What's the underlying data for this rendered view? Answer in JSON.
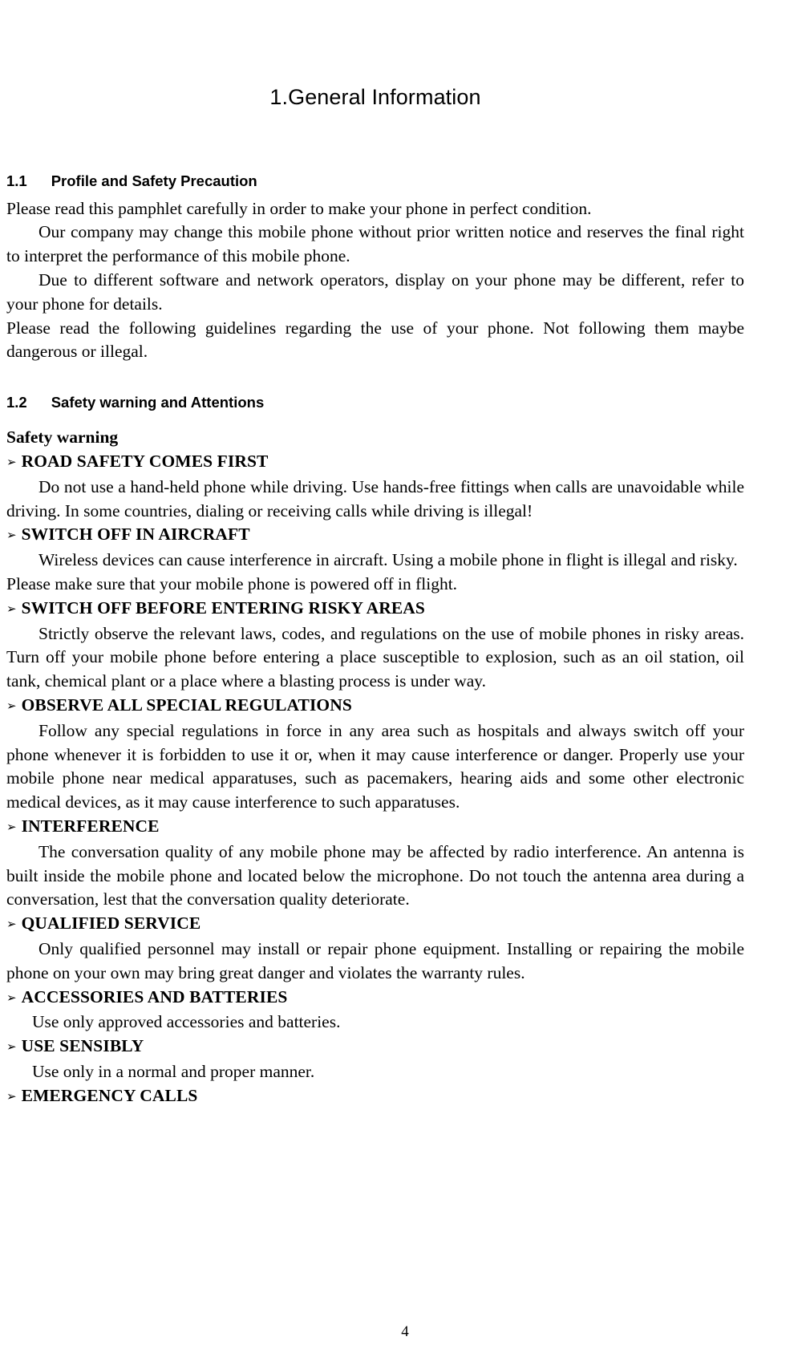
{
  "document": {
    "title": "1.General Information",
    "page_number": "4",
    "bullet_glyph": "➢"
  },
  "sections": [
    {
      "number": "1.1",
      "label": "Profile and Safety Precaution",
      "paragraphs": [
        "Please read this pamphlet carefully in order to make your phone in perfect condition.",
        "Our company may change this mobile phone without prior written notice and reserves the final right to interpret the performance of this mobile phone.",
        "Due to different software and network operators, display on your phone may be different, refer to your phone for details.",
        "Please read the following guidelines regarding the use of your phone. Not following them maybe dangerous or illegal."
      ]
    },
    {
      "number": "1.2",
      "label": "Safety warning and Attentions",
      "subheading": "Safety warning",
      "items": [
        {
          "heading": "ROAD SAFETY COMES FIRST",
          "body": "Do not use a hand-held phone while driving. Use hands-free fittings when calls are unavoidable while driving. In some countries, dialing or receiving calls while driving is illegal!"
        },
        {
          "heading": "SWITCH OFF IN AIRCRAFT",
          "body": "Wireless devices can cause interference in aircraft. Using a mobile phone in flight is illegal and risky.",
          "body2": "Please make sure that your mobile phone is powered off in flight."
        },
        {
          "heading": "SWITCH OFF BEFORE ENTERING RISKY AREAS",
          "body": "Strictly observe the relevant laws, codes, and regulations on the use of mobile phones in risky areas. Turn off your mobile phone before entering a place susceptible to explosion, such as an oil station, oil tank, chemical plant or a place where a blasting process is under way."
        },
        {
          "heading": "OBSERVE ALL SPECIAL REGULATIONS",
          "body": "Follow any special regulations in force in any area such as hospitals and always switch off your phone whenever it is forbidden to use it or, when it may cause interference or danger. Properly use your mobile phone near medical apparatuses, such as pacemakers, hearing aids and some other electronic medical devices, as it may cause interference to such apparatuses."
        },
        {
          "heading": "INTERFERENCE",
          "body": "The conversation quality of any mobile phone may be affected by radio interference. An antenna is built inside the mobile phone and located below the microphone. Do not touch the antenna area during a conversation, lest that the conversation quality deteriorate."
        },
        {
          "heading": "QUALIFIED SERVICE",
          "body": "Only qualified personnel may install or repair phone equipment. Installing or repairing the mobile phone on your own may bring great danger and violates the warranty rules."
        },
        {
          "heading": "ACCESSORIES AND BATTERIES",
          "body": "Use only approved accessories and batteries."
        },
        {
          "heading": "USE SENSIBLY",
          "body": "Use only in a normal and proper manner."
        },
        {
          "heading": "EMERGENCY CALLS",
          "body": ""
        }
      ]
    }
  ]
}
